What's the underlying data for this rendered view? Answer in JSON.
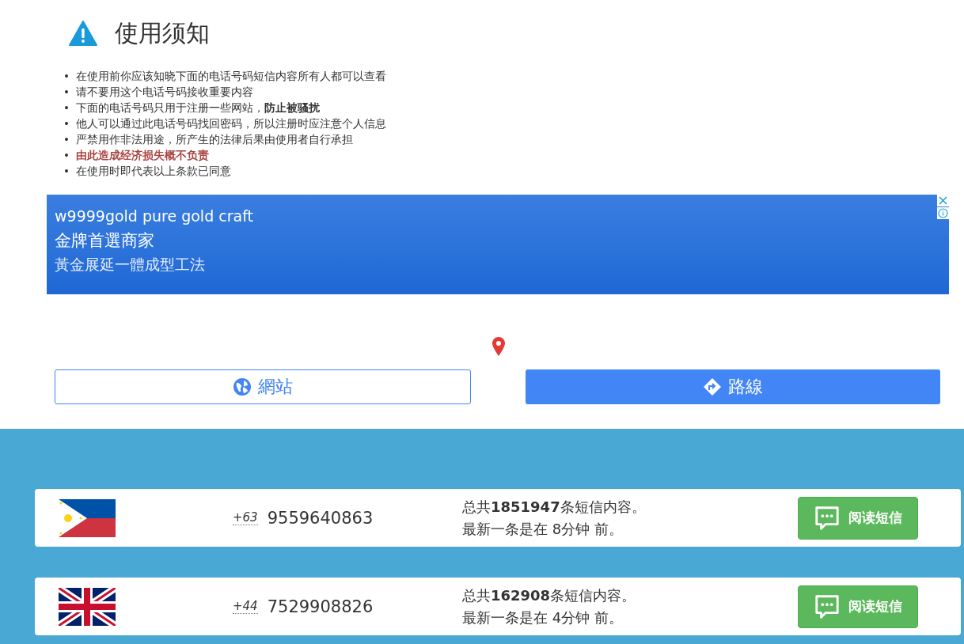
{
  "notice": {
    "title": "使用须知",
    "bullet": "•",
    "items": [
      {
        "text": "在使用前你应该知晓下面的电话号码短信内容所有人都可以查看",
        "kind": "normal"
      },
      {
        "text": "请不要用这个电话号码接收重要内容",
        "kind": "normal"
      },
      {
        "text": "下面的电话号码只用于注册一些网站，**防止被骚扰**",
        "kind": "normal"
      },
      {
        "text": "他人可以通过此电话号码找回密码，所以注册时应注意个人信息",
        "kind": "normal"
      },
      {
        "text": "严禁用作非法用途，所产生的法律后果由使用者自行承担",
        "kind": "normal"
      },
      {
        "text": "**由此造成经济损失概不负责**",
        "kind": "warning"
      },
      {
        "text": "在使用时即代表以上条款已同意",
        "kind": "normal"
      }
    ]
  },
  "ad": {
    "headline": "w9999gold pure gold craft",
    "line_1": "金牌首選商家",
    "line_2": "黃金展延一體成型工法",
    "buttons": [
      {
        "label": "網站",
        "kind": "website"
      },
      {
        "label": "路線",
        "kind": "directions"
      }
    ]
  },
  "numbers": [
    {
      "kind": "ph",
      "code": "+63",
      "number": "9559640863",
      "total": "总共**1851947**条短信内容。",
      "latest": "最新一条是在 8分钟 前。",
      "button": "阅读短信"
    },
    {
      "kind": "gb",
      "code": "+44",
      "number": "7529908826",
      "total": "总共**162908**条短信内容。",
      "latest": "最新一条是在 4分钟 前。",
      "button": "阅读短信"
    }
  ]
}
